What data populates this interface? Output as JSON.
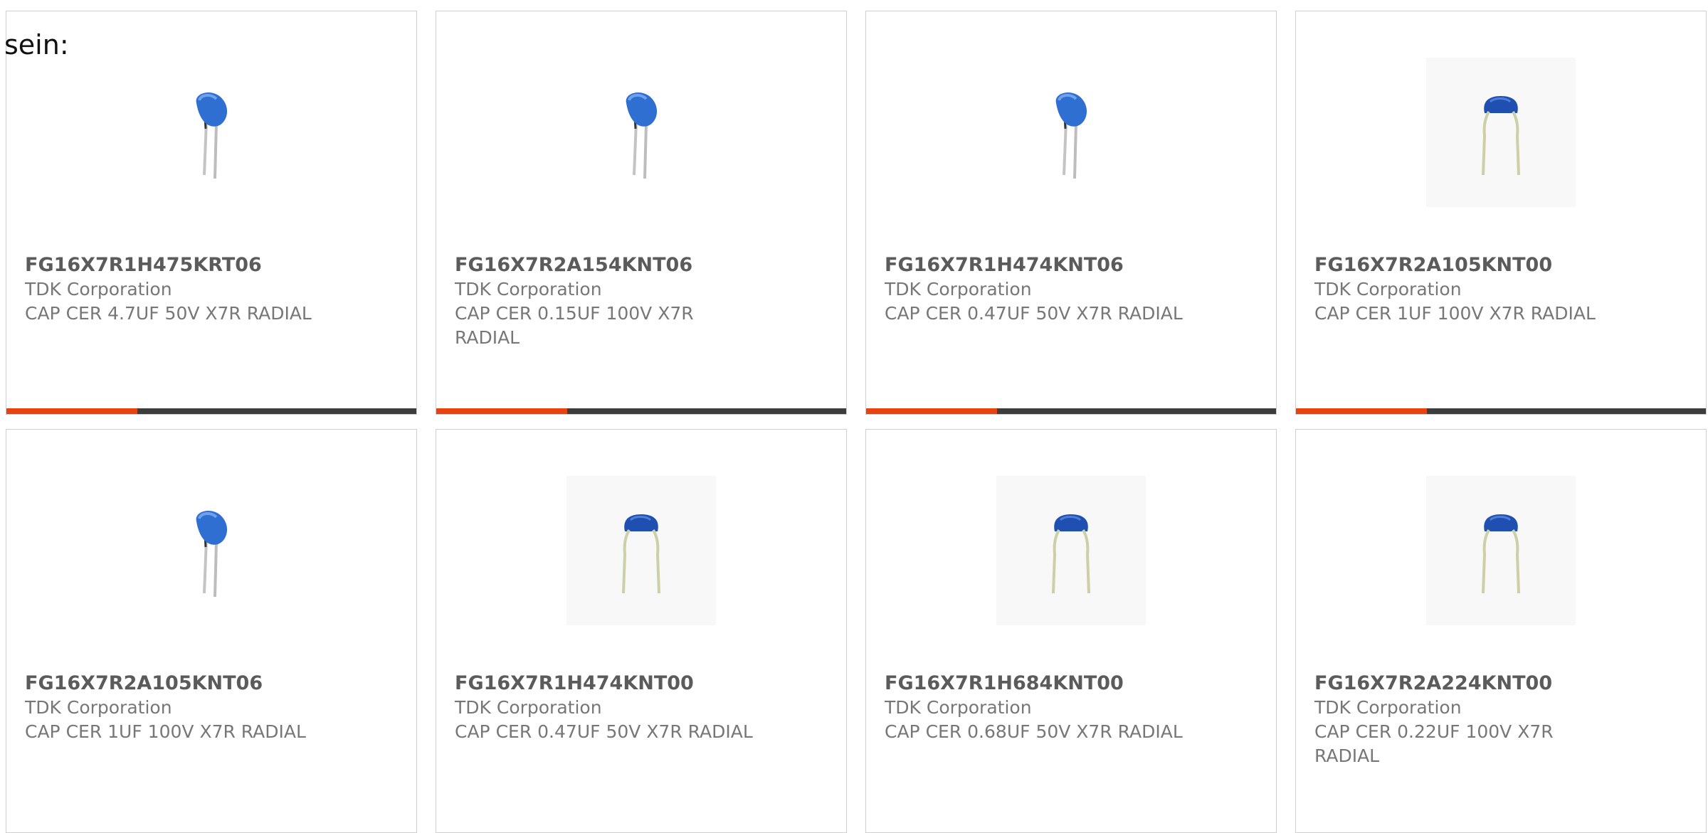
{
  "intro_text": "sein:",
  "colors": {
    "accent": "#e8430f",
    "bar_dark": "#3d3d3d",
    "capacitor_blue": "#2e6fd1"
  },
  "products": [
    {
      "part_number": "FG16X7R1H475KRT06",
      "manufacturer": "TDK Corporation",
      "description": "CAP CER 4.7UF 50V X7R RADIAL",
      "image": "capacitor-side-icon",
      "progress": 0.32
    },
    {
      "part_number": "FG16X7R2A154KNT06",
      "manufacturer": "TDK Corporation",
      "description": "CAP CER 0.15UF 100V X7R RADIAL",
      "image": "capacitor-side-icon",
      "progress": 0.32
    },
    {
      "part_number": "FG16X7R1H474KNT06",
      "manufacturer": "TDK Corporation",
      "description": "CAP CER 0.47UF 50V X7R RADIAL",
      "image": "capacitor-side-icon",
      "progress": 0.32
    },
    {
      "part_number": "FG16X7R2A105KNT00",
      "manufacturer": "TDK Corporation",
      "description": "CAP CER 1UF 100V X7R RADIAL",
      "image": "capacitor-front-icon",
      "progress": 0.32
    },
    {
      "part_number": "FG16X7R2A105KNT06",
      "manufacturer": "TDK Corporation",
      "description": "CAP CER 1UF 100V X7R RADIAL",
      "image": "capacitor-side-icon",
      "progress": null
    },
    {
      "part_number": "FG16X7R1H474KNT00",
      "manufacturer": "TDK Corporation",
      "description": "CAP CER 0.47UF 50V X7R RADIAL",
      "image": "capacitor-front-icon",
      "progress": null
    },
    {
      "part_number": "FG16X7R1H684KNT00",
      "manufacturer": "TDK Corporation",
      "description": "CAP CER 0.68UF 50V X7R RADIAL",
      "image": "capacitor-front-icon",
      "progress": null
    },
    {
      "part_number": "FG16X7R2A224KNT00",
      "manufacturer": "TDK Corporation",
      "description": "CAP CER 0.22UF 100V X7R RADIAL",
      "image": "capacitor-front-icon",
      "progress": null
    }
  ]
}
